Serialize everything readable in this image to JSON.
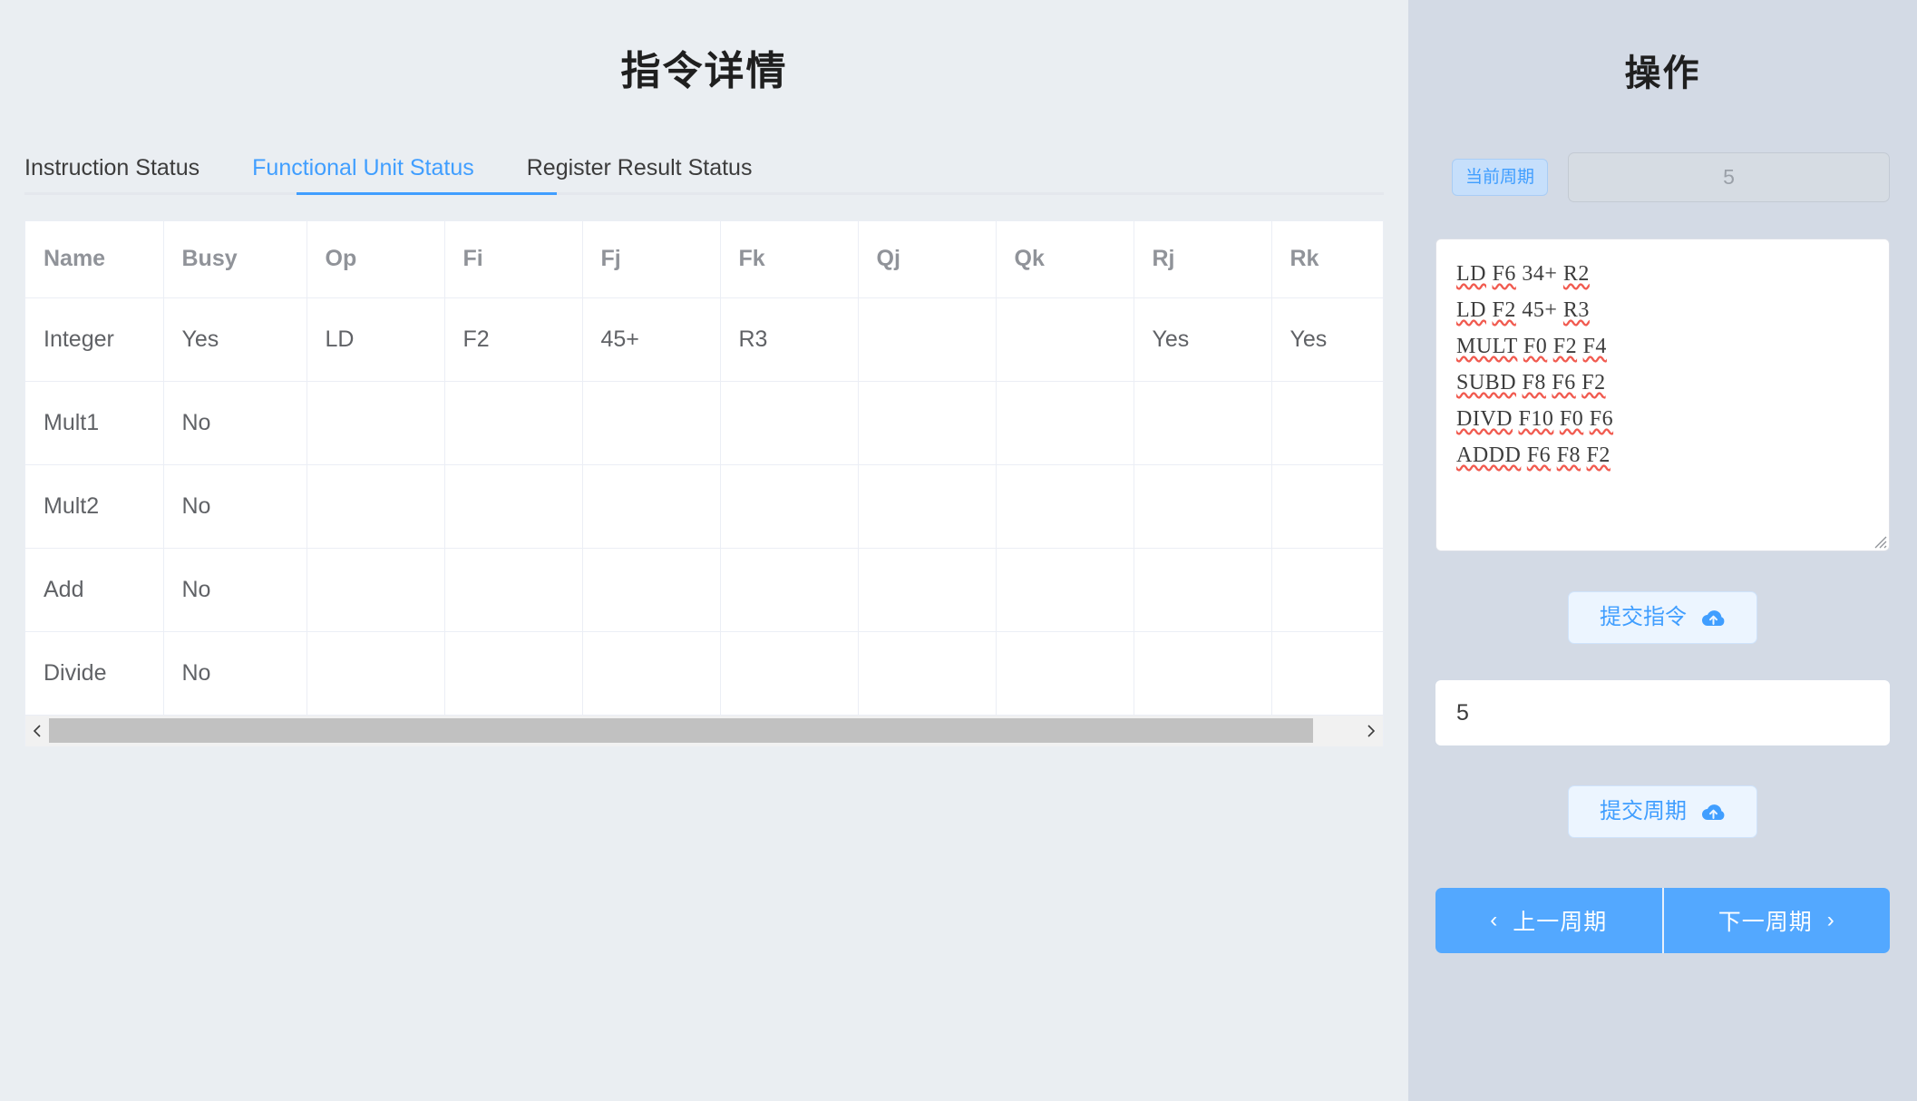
{
  "left": {
    "title": "指令详情",
    "tabs": [
      {
        "label": "Instruction Status",
        "active": false
      },
      {
        "label": "Functional Unit Status",
        "active": true
      },
      {
        "label": "Register Result Status",
        "active": false
      }
    ],
    "table": {
      "columns": [
        "Name",
        "Busy",
        "Op",
        "Fi",
        "Fj",
        "Fk",
        "Qj",
        "Qk",
        "Rj",
        "Rk"
      ],
      "rows": [
        {
          "Name": "Integer",
          "Busy": "Yes",
          "Op": "LD",
          "Fi": "F2",
          "Fj": "45+",
          "Fk": "R3",
          "Qj": "",
          "Qk": "",
          "Rj": "Yes",
          "Rk": "Yes"
        },
        {
          "Name": "Mult1",
          "Busy": "No",
          "Op": "",
          "Fi": "",
          "Fj": "",
          "Fk": "",
          "Qj": "",
          "Qk": "",
          "Rj": "",
          "Rk": ""
        },
        {
          "Name": "Mult2",
          "Busy": "No",
          "Op": "",
          "Fi": "",
          "Fj": "",
          "Fk": "",
          "Qj": "",
          "Qk": "",
          "Rj": "",
          "Rk": ""
        },
        {
          "Name": "Add",
          "Busy": "No",
          "Op": "",
          "Fi": "",
          "Fj": "",
          "Fk": "",
          "Qj": "",
          "Qk": "",
          "Rj": "",
          "Rk": ""
        },
        {
          "Name": "Divide",
          "Busy": "No",
          "Op": "",
          "Fi": "",
          "Fj": "",
          "Fk": "",
          "Qj": "",
          "Qk": "",
          "Rj": "",
          "Rk": ""
        }
      ]
    }
  },
  "right": {
    "title": "操作",
    "cycle_tag_label": "当前周期",
    "cycle_display_value": "5",
    "instructions": [
      "LD F6 34+ R2",
      "LD F2 45+ R3",
      "MULT F0 F2 F4",
      "SUBD F8 F6 F2",
      "DIVD F10 F0 F6",
      "ADDD F6 F8 F2"
    ],
    "submit_instructions_label": "提交指令",
    "cycle_input_value": "5",
    "submit_cycle_label": "提交周期",
    "prev_cycle_label": "上一周期",
    "next_cycle_label": "下一周期",
    "icons": {
      "upload_cloud": "cloud-upload-icon",
      "chevron_left": "‹",
      "chevron_right": "›"
    }
  },
  "colors": {
    "accent": "#409eff",
    "nav_button": "#53a8ff",
    "left_bg": "#eaeef2",
    "right_bg": "#d3dae5",
    "header_text": "#909399",
    "body_text": "#606266",
    "spellcheck": "#f15b50"
  }
}
